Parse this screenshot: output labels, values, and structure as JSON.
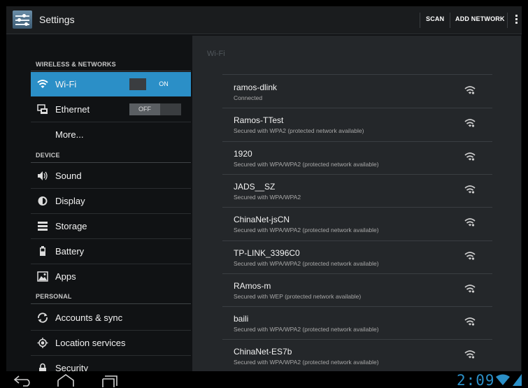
{
  "header": {
    "title": "Settings",
    "scan_label": "SCAN",
    "add_network_label": "ADD NETWORK",
    "app_icon": "settings-sliders-icon",
    "overflow_icon": "overflow-menu-icon"
  },
  "sidebar": {
    "sections": {
      "wireless": "WIRELESS & NETWORKS",
      "device": "DEVICE",
      "personal": "PERSONAL"
    },
    "wifi": {
      "label": "Wi-Fi",
      "toggle": "ON",
      "icon": "wifi-icon"
    },
    "ethernet": {
      "label": "Ethernet",
      "toggle": "OFF",
      "icon": "ethernet-icon"
    },
    "more": {
      "label": "More..."
    },
    "sound": {
      "label": "Sound",
      "icon": "speaker-icon"
    },
    "display": {
      "label": "Display",
      "icon": "brightness-icon"
    },
    "storage": {
      "label": "Storage",
      "icon": "storage-icon"
    },
    "battery": {
      "label": "Battery",
      "icon": "battery-icon"
    },
    "apps": {
      "label": "Apps",
      "icon": "apps-icon"
    },
    "accounts": {
      "label": "Accounts & sync",
      "icon": "sync-icon"
    },
    "location": {
      "label": "Location services",
      "icon": "location-icon"
    },
    "security": {
      "label": "Security",
      "icon": "lock-icon"
    }
  },
  "wifi_panel": {
    "title": "Wi-Fi",
    "networks": [
      {
        "name": "ramos-dlink",
        "status": "Connected"
      },
      {
        "name": "Ramos-TTest",
        "status": "Secured with WPA2 (protected network available)"
      },
      {
        "name": "1920",
        "status": "Secured with WPA/WPA2 (protected network available)"
      },
      {
        "name": "JADS__SZ",
        "status": "Secured with WPA/WPA2"
      },
      {
        "name": "ChinaNet-jsCN",
        "status": "Secured with WPA/WPA2 (protected network available)"
      },
      {
        "name": "TP-LINK_3396C0",
        "status": "Secured with WPA/WPA2 (protected network available)"
      },
      {
        "name": "RAmos-m",
        "status": "Secured with WEP (protected network available)"
      },
      {
        "name": "baili",
        "status": "Secured with WPA/WPA2 (protected network available)"
      },
      {
        "name": "ChinaNet-ES7b",
        "status": "Secured with WPA/WPA2 (protected network available)"
      }
    ]
  },
  "navbar": {
    "clock": "2:09",
    "back_icon": "back-icon",
    "home_icon": "home-icon",
    "recents_icon": "recents-icon"
  },
  "colors": {
    "accent": "#2b8fc7",
    "background": "#101214",
    "panel": "#24272a"
  }
}
